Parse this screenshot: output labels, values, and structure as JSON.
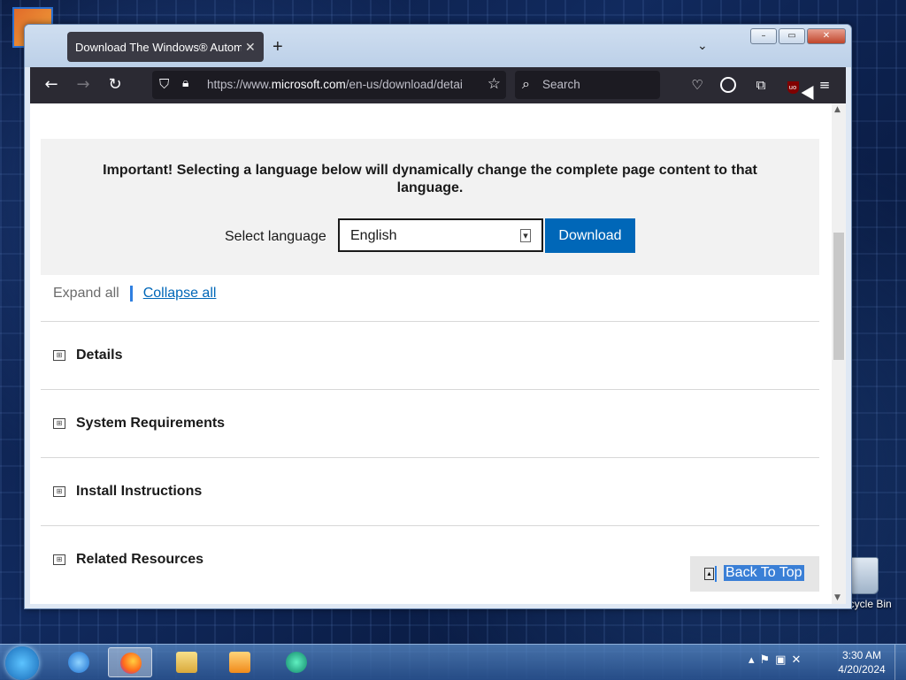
{
  "browser": {
    "tab_title": "Download The Windows® Automat",
    "tab_close": "✕",
    "new_tab": "+",
    "tab_list": "⌄",
    "url_prefix": "https://www.",
    "url_domain": "microsoft.com",
    "url_rest": "/en-us/download/detai",
    "search_placeholder": "Search"
  },
  "page": {
    "important_text": "Important! Selecting a language below will dynamically change the complete page content to that language.",
    "select_language_label": "Select language",
    "selected_language": "English",
    "download_button": "Download",
    "expand_all": "Expand all",
    "collapse_all": "Collapse all",
    "sections": [
      "Details",
      "System Requirements",
      "Install Instructions",
      "Related Resources"
    ],
    "back_to_top": "Back To Top"
  },
  "desktop": {
    "recycle_bin_label": "Recycle Bin"
  },
  "taskbar": {
    "time": "3:30 AM",
    "date": "4/20/2024"
  },
  "colors": {
    "accent": "#0067b8",
    "browser_toolbar": "#2b2a33"
  }
}
